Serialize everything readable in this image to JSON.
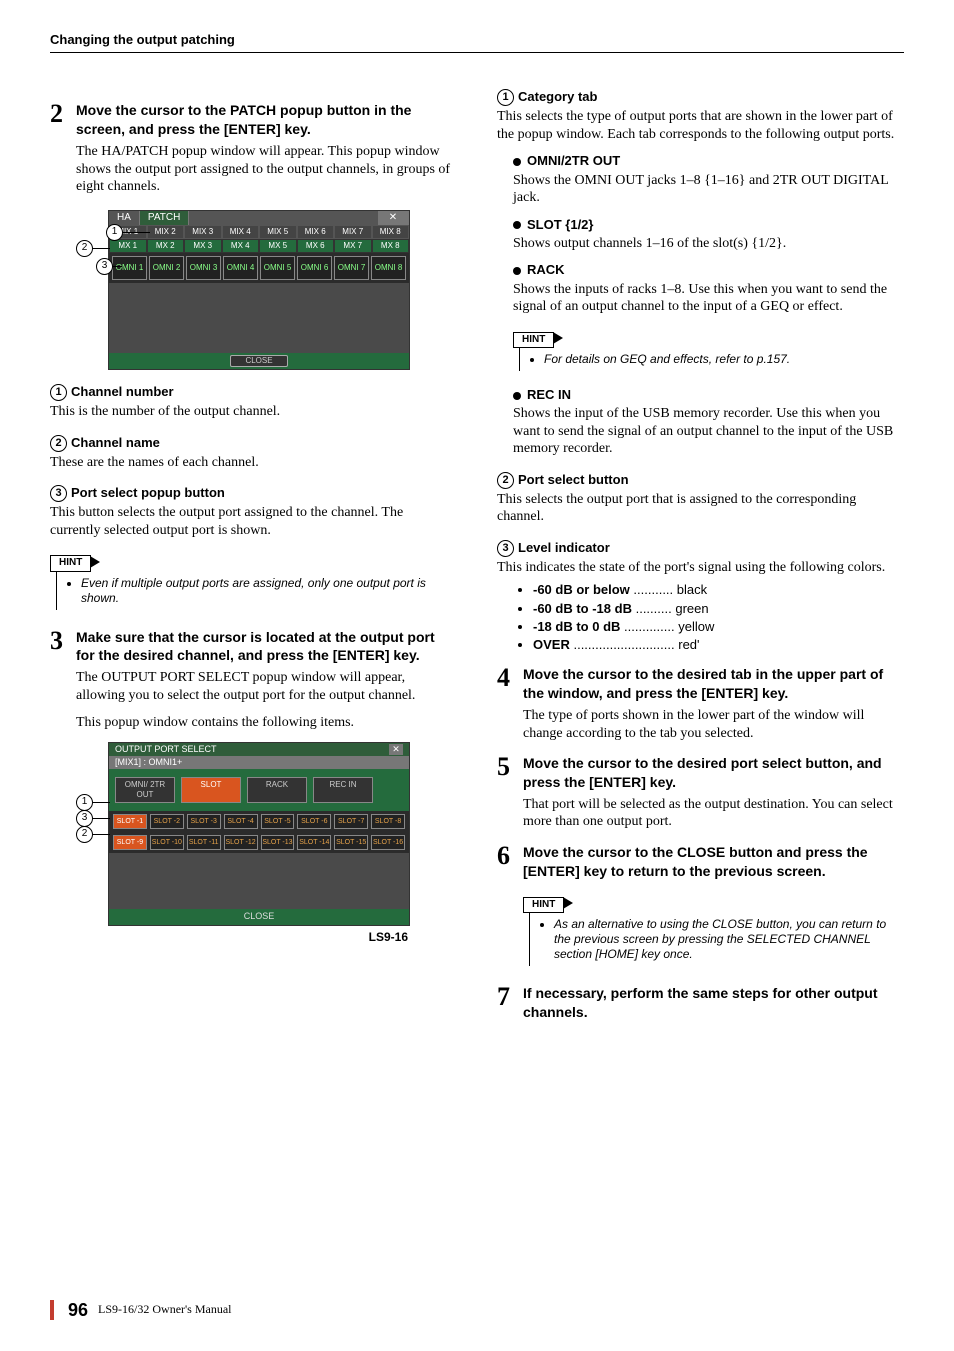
{
  "running_head": "Changing the output patching",
  "left": {
    "step2": {
      "head": "Move the cursor to the PATCH popup button in the screen, and press the [ENTER] key.",
      "body": "The HA/PATCH popup window will appear. This popup window shows the output port assigned to the output channels, in groups of eight channels."
    },
    "fig1": {
      "tab_ha": "HA",
      "tab_patch": "PATCH",
      "x": "✕",
      "mix_tabs": [
        "MIX 1",
        "MIX 2",
        "MIX 3",
        "MIX 4",
        "MIX 5",
        "MIX 6",
        "MIX 7",
        "MIX 8"
      ],
      "mix_names": [
        "MX 1",
        "MX 2",
        "MX 3",
        "MX 4",
        "MX 5",
        "MX 6",
        "MX 7",
        "MX 8"
      ],
      "cells": [
        "OMNI 1",
        "OMNI 2",
        "OMNI 3",
        "OMNI 4",
        "OMNI 5",
        "OMNI 6",
        "OMNI 7",
        "OMNI 8"
      ],
      "close": "CLOSE"
    },
    "item1": {
      "head": "Channel number",
      "body": "This is the number of the output channel."
    },
    "item2": {
      "head": "Channel name",
      "body": "These are the names of each channel."
    },
    "item3": {
      "head": "Port select popup button",
      "body": "This button selects the output port assigned to the channel. The currently selected output port is shown."
    },
    "hint1_label": "HINT",
    "hint1": "Even if multiple output ports are assigned, only one output port is shown.",
    "step3": {
      "head": "Make sure that the cursor is located at the output port for the desired channel, and press the [ENTER] key.",
      "body1": "The OUTPUT PORT SELECT popup window will appear, allowing you to select the output port for the output channel.",
      "body2": "This popup window contains the following items."
    },
    "fig2": {
      "title": "OUTPUT PORT SELECT",
      "x": "✕",
      "sub": "[MIX1] : OMNI1+",
      "tabs": [
        "OMNI/ 2TR OUT",
        "SLOT",
        "RACK",
        "REC IN"
      ],
      "row1": [
        "SLOT -1",
        "SLOT -2",
        "SLOT -3",
        "SLOT -4",
        "SLOT -5",
        "SLOT -6",
        "SLOT -7",
        "SLOT -8"
      ],
      "row2": [
        "SLOT -9",
        "SLOT -10",
        "SLOT -11",
        "SLOT -12",
        "SLOT -13",
        "SLOT -14",
        "SLOT -15",
        "SLOT -16"
      ],
      "close": "CLOSE",
      "caption": "LS9-16"
    }
  },
  "right": {
    "cat": {
      "head": "Category tab",
      "body": "This selects the type of output ports that are shown in the lower part of the popup window. Each tab corresponds to the following output ports."
    },
    "omni": {
      "head": "OMNI/2TR OUT",
      "body": "Shows the OMNI OUT jacks 1–8 {1–16} and 2TR OUT DIGITAL jack."
    },
    "slot": {
      "head": "SLOT {1/2}",
      "body": "Shows output channels 1–16 of the slot(s) {1/2}."
    },
    "rack": {
      "head": "RACK",
      "body": "Shows the inputs of racks 1–8. Use this when you want to send the signal of an output channel to the input of a GEQ or effect."
    },
    "hint2_label": "HINT",
    "hint2": "For details on GEQ and effects, refer to p.157.",
    "recin": {
      "head": "REC IN",
      "body": "Shows the input of the USB memory recorder. Use this when you want to send the signal of an output channel to the input of the USB memory recorder."
    },
    "portsel": {
      "head": "Port select button",
      "body": "This selects the output port that is assigned to the corresponding channel."
    },
    "level": {
      "head": "Level indicator",
      "body": "This indicates the state of the port's signal using the following colors."
    },
    "levels": [
      {
        "l": "-60 dB or below",
        "d": "...........",
        "r": "black"
      },
      {
        "l": "-60 dB to -18 dB",
        "d": "..........",
        "r": "green"
      },
      {
        "l": "-18 dB to 0 dB",
        "d": "..............",
        "r": "yellow"
      },
      {
        "l": "OVER",
        "d": "............................",
        "r": "red'"
      }
    ],
    "step4": {
      "head": "Move the cursor to the desired tab in the upper part of the window, and press the [ENTER] key.",
      "body": "The type of ports shown in the lower part of the window will change according to the tab you selected."
    },
    "step5": {
      "head": "Move the cursor to the desired port select button, and press the [ENTER] key.",
      "body": "That port will be selected as the output destination. You can select more than one output port."
    },
    "step6": {
      "head": "Move the cursor to the CLOSE button and press the [ENTER] key to return to the previous screen."
    },
    "hint3_label": "HINT",
    "hint3": "As an alternative to using the CLOSE button, you can return to the previous screen by pressing the SELECTED CHANNEL section [HOME] key once.",
    "step7": {
      "head": "If necessary, perform the same steps for other output channels."
    }
  },
  "footer": {
    "page": "96",
    "owner": "LS9-16/32  Owner's Manual"
  }
}
